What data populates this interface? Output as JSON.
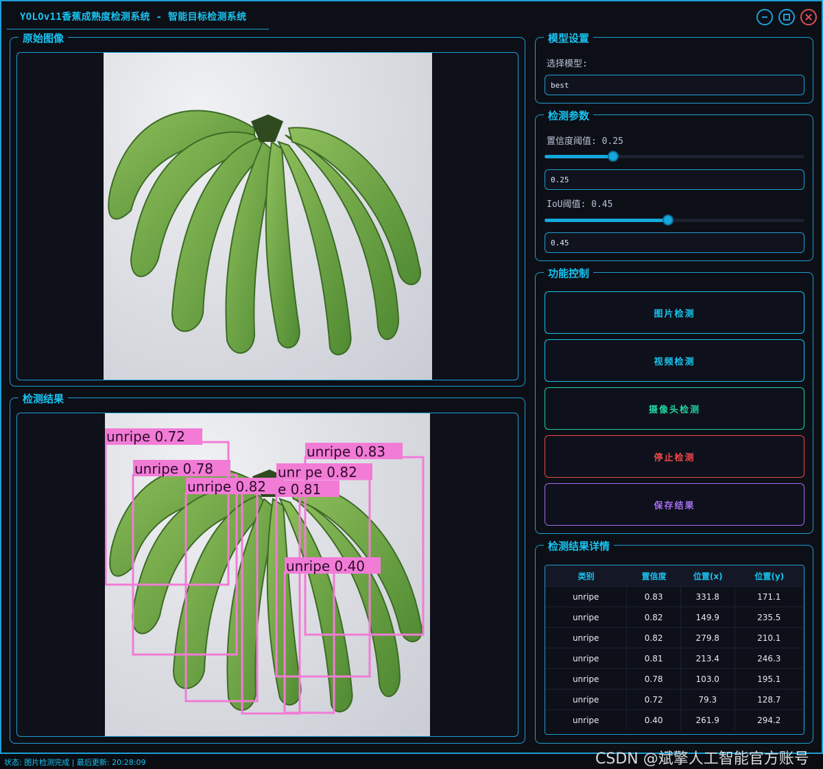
{
  "window": {
    "title": "YOLOv11香蕉成熟度检测系统 - 智能目标检测系统",
    "controls": [
      "minimize-icon",
      "maximize-icon",
      "close-icon"
    ]
  },
  "original_panel": {
    "title": "原始图像"
  },
  "result_panel": {
    "title": "检测结果"
  },
  "detections_overlay": [
    {
      "label": "unripe 0.72"
    },
    {
      "label": "unripe 0.78"
    },
    {
      "label": "unripe 0.82"
    },
    {
      "label": "e 0.81"
    },
    {
      "label": "unripe 0.83"
    },
    {
      "label": "unr pe 0.82"
    },
    {
      "label": "unripe 0.40"
    }
  ],
  "model_settings": {
    "title": "模型设置",
    "select_label": "选择模型:",
    "selected_model": "best"
  },
  "detect_params": {
    "title": "检测参数",
    "conf_label": "置信度阈值: 0.25",
    "conf_value": "0.25",
    "conf_level": 0.25,
    "iou_label": "IoU阈值: 0.45",
    "iou_value": "0.45",
    "iou_level": 0.45
  },
  "function_control": {
    "title": "功能控制",
    "image_detect": "图片检测",
    "video_detect": "视频检测",
    "camera_detect": "摄像头检测",
    "stop_detect": "停止检测",
    "save_result": "保存结果",
    "colors": {
      "image": "#18c4f0",
      "video": "#18c4f0",
      "camera": "#22d3a0",
      "stop": "#f04848",
      "save": "#a66cf0"
    }
  },
  "results_detail": {
    "title": "检测结果详情",
    "columns": [
      "类别",
      "置信度",
      "位置(x)",
      "位置(y)"
    ],
    "rows": [
      [
        "unripe",
        "0.83",
        "331.8",
        "171.1"
      ],
      [
        "unripe",
        "0.82",
        "149.9",
        "235.5"
      ],
      [
        "unripe",
        "0.82",
        "279.8",
        "210.1"
      ],
      [
        "unripe",
        "0.81",
        "213.4",
        "246.3"
      ],
      [
        "unripe",
        "0.78",
        "103.0",
        "195.1"
      ],
      [
        "unripe",
        "0.72",
        "79.3",
        "128.7"
      ],
      [
        "unripe",
        "0.40",
        "261.9",
        "294.2"
      ]
    ]
  },
  "status_bar": {
    "text": "状态: 图片检测完成 | 最后更新: 20:28:09"
  },
  "watermark": "CSDN @斌擎人工智能官方账号"
}
